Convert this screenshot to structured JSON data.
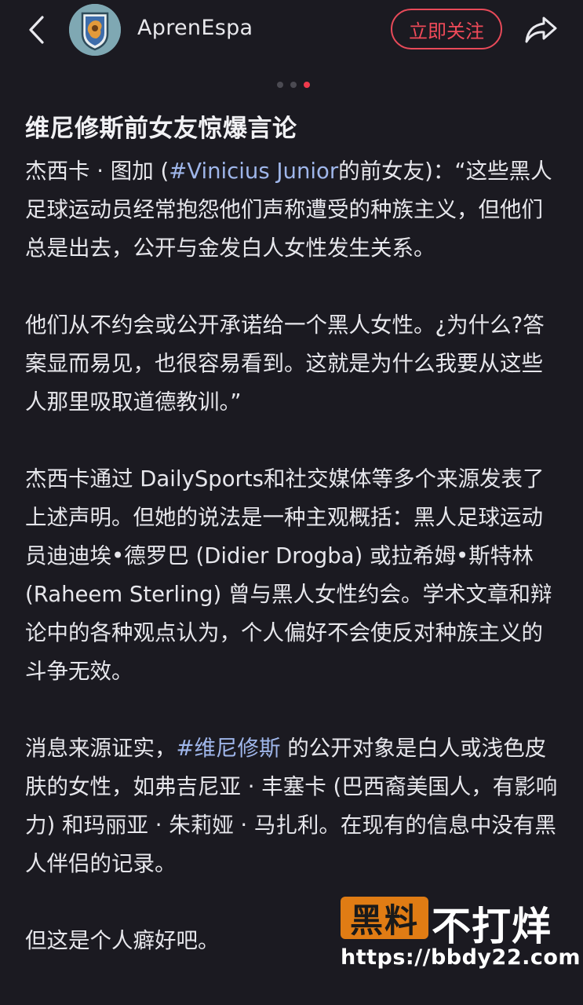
{
  "header": {
    "username": "AprenEspa",
    "follow_label": "立即关注"
  },
  "post": {
    "title": "维尼修斯前女友惊爆言论",
    "p1_pre": "杰西卡 · 图加 (",
    "p1_tag": "#Vinicius  Junior",
    "p1_post": "的前女友)：“这些黑人足球运动员经常抱怨他们声称遭受的种族主义，但他们总是出去，公开与金发白人女性发生关系。",
    "p2": "他们从不约会或公开承诺给一个黑人女性。¿为什么?答案显而易见，也很容易看到。这就是为什么我要从这些人那里吸取道德教训。”",
    "p3": "杰西卡通过 DailySports和社交媒体等多个来源发表了上述声明。但她的说法是一种主观概括：黑人足球运动员迪迪埃•德罗巴 (Didier Drogba) 或拉希姆•斯特林 (Raheem Sterling) 曾与黑人女性约会。学术文章和辩论中的各种观点认为，个人偏好不会使反对种族主义的斗争无效。",
    "p4_pre": "消息来源证实，",
    "p4_tag": "#维尼修斯",
    "p4_post": " 的公开对象是白人或浅色皮肤的女性，如弗吉尼亚 · 丰塞卡 (巴西裔美国人，有影响力) 和玛丽亚 · 朱莉娅 · 马扎利。在现有的信息中没有黑人伴侣的记录。",
    "p5": "但这是个人癖好吧。"
  },
  "watermark": {
    "box_text": "黑料",
    "text": "不打烊",
    "url": "https://bbdy22.com"
  },
  "carousel": {
    "count": 3,
    "active_index": 2
  },
  "colors": {
    "accent": "#ef3a4c",
    "tag": "#9fb6ea",
    "background": "#1b1a21"
  },
  "icons": [
    "back-arrow-icon",
    "share-icon"
  ]
}
